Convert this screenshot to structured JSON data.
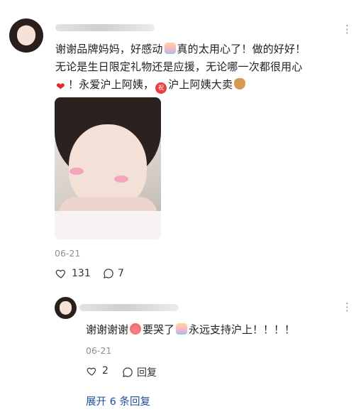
{
  "post": {
    "text_line1_a": "谢谢品牌妈妈，好感动",
    "text_line1_b": "真的太用心了！做的好好！",
    "text_line2": "无论是生日限定礼物还是应援，无论哪一次都很用心",
    "text_line3_a": "！永爱沪上阿姨，",
    "text_line3_b": "沪上阿姨大卖",
    "date": "06-21",
    "like_count": "131",
    "comment_count": "7",
    "icons": {
      "more": "more-dots-icon",
      "like": "heart-outline-icon",
      "comment": "comment-bubble-icon",
      "emoji_moved": "moved-emoji-icon",
      "emoji_heart": "red-heart-icon",
      "emoji_wish": "wish-emoji-icon",
      "emoji_money": "money-bag-icon"
    }
  },
  "reply": {
    "text_a": "谢谢谢谢",
    "text_b": "要哭了",
    "text_c": "永远支持沪上！！！！",
    "date": "06-21",
    "like_count": "2",
    "reply_label": "回复",
    "icons": {
      "more": "more-dots-icon",
      "like": "heart-outline-icon",
      "comment": "comment-bubble-icon",
      "emoji_peach": "peach-emoji-icon",
      "emoji_moved": "moved-emoji-icon"
    }
  },
  "expand_replies": "展开 6 条回复",
  "colors": {
    "link": "#1f4f9d",
    "meta": "#8f8f8f",
    "heart": "#e0282f"
  }
}
